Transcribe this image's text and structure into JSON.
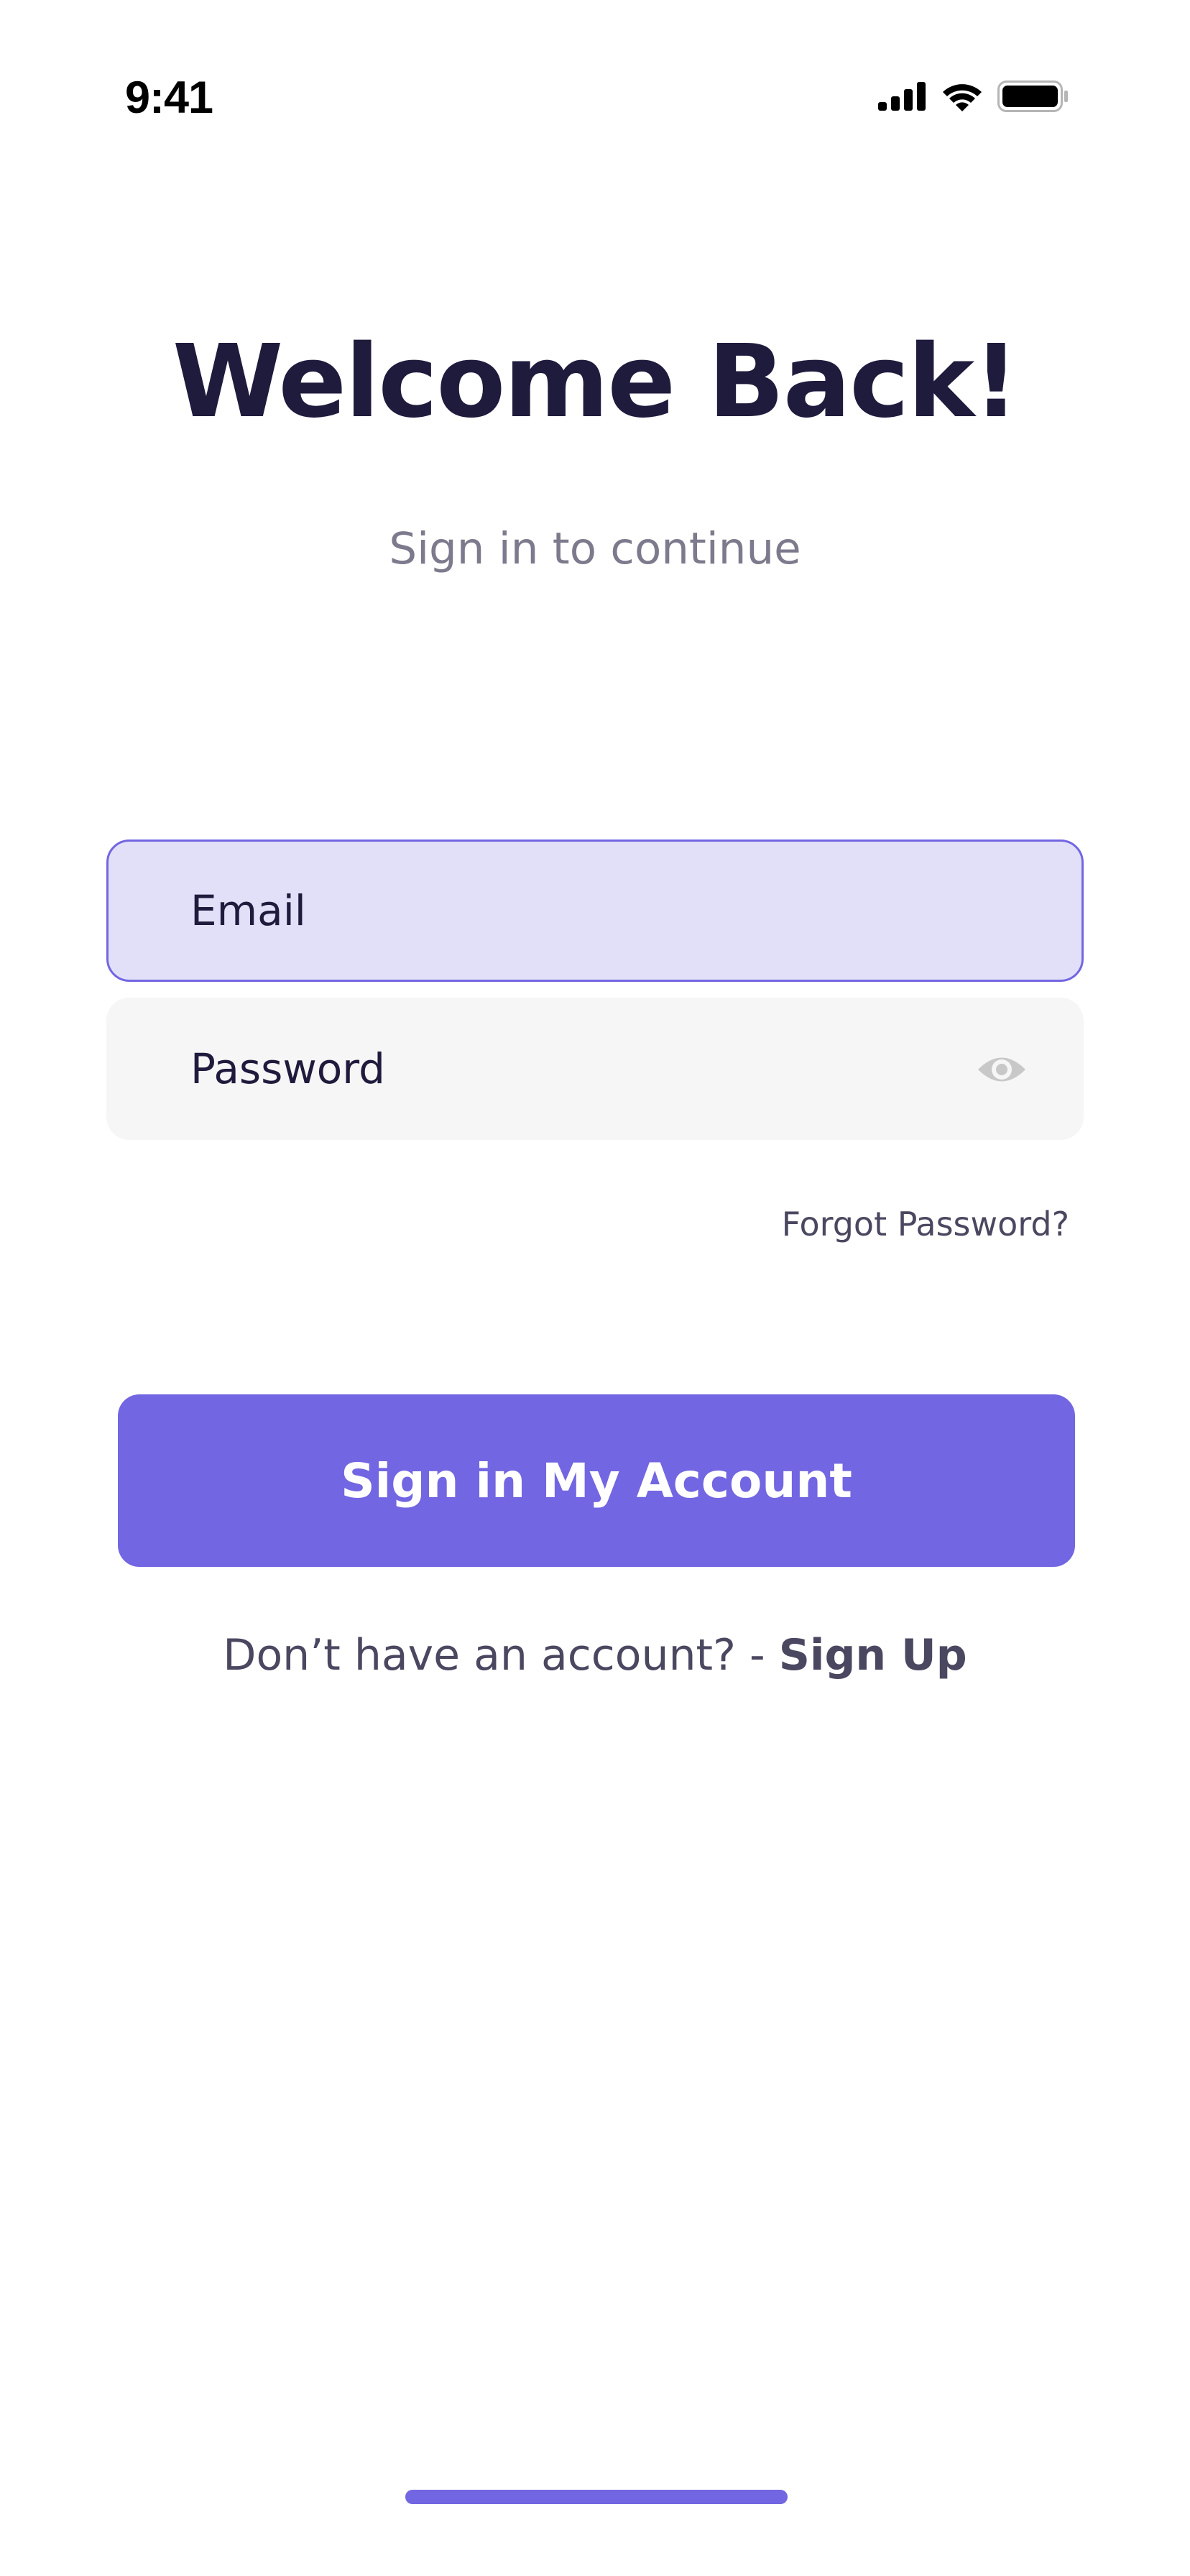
{
  "status_bar": {
    "time": "9:41",
    "icons": [
      "cellular-signal-icon",
      "wifi-icon",
      "battery-icon"
    ]
  },
  "header": {
    "title": "Welcome Back!",
    "subtitle": "Sign in to continue"
  },
  "form": {
    "email": {
      "placeholder": "Email",
      "value": ""
    },
    "password": {
      "placeholder": "Password",
      "value": "",
      "toggle_icon": "eye-icon"
    },
    "forgot_password": "Forgot Password?",
    "submit_label": "Sign in My Account"
  },
  "footer": {
    "prompt": "Don’t have an account? - ",
    "signup_label": "Sign Up"
  },
  "colors": {
    "accent": "#7266e2",
    "title": "#1f1b3d",
    "email_field_bg": "#e2e0f8",
    "password_field_bg": "#f6f6f6"
  }
}
